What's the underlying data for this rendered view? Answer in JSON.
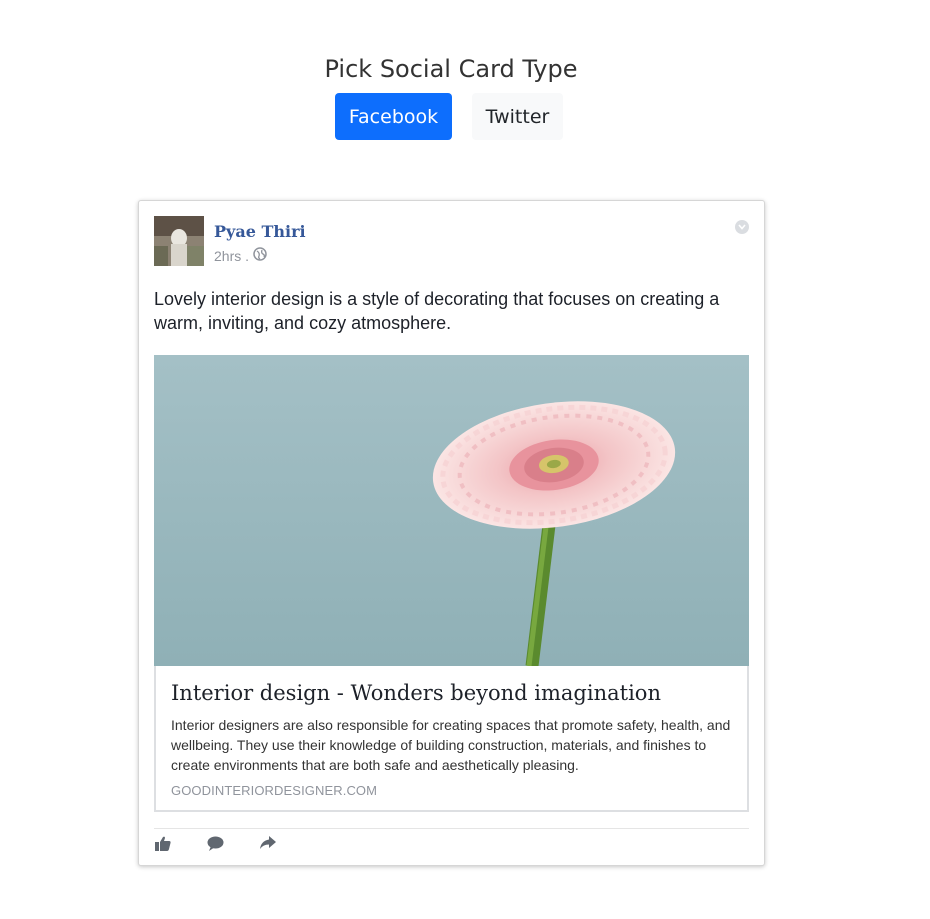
{
  "picker": {
    "title": "Pick Social Card Type",
    "facebook_label": "Facebook",
    "twitter_label": "Twitter"
  },
  "post": {
    "author": "Pyae Thiri",
    "time": "2hrs .",
    "text": "Lovely interior design is a style of decorating that focuses on creating a warm, inviting, and cozy atmosphere.",
    "privacy_icon": "globe-icon",
    "menu_icon": "chevron-down-icon"
  },
  "preview": {
    "image_icon": "pink-gerbera-flower-image",
    "title": "Interior design - Wonders beyond imagination",
    "description": "Interior designers are also responsible for creating spaces that promote safety, health, and wellbeing. They use their knowledge of building construction, materials, and finishes to create environments that are both safe and aesthetically pleasing.",
    "domain": "GOODINTERIORDESIGNER.COM"
  },
  "actions": [
    "like-icon",
    "comment-icon",
    "share-icon"
  ],
  "colors": {
    "primary_button": "#0d6efd",
    "secondary_button": "#f8f9fa",
    "author_link": "#365899",
    "muted": "#90949c"
  }
}
